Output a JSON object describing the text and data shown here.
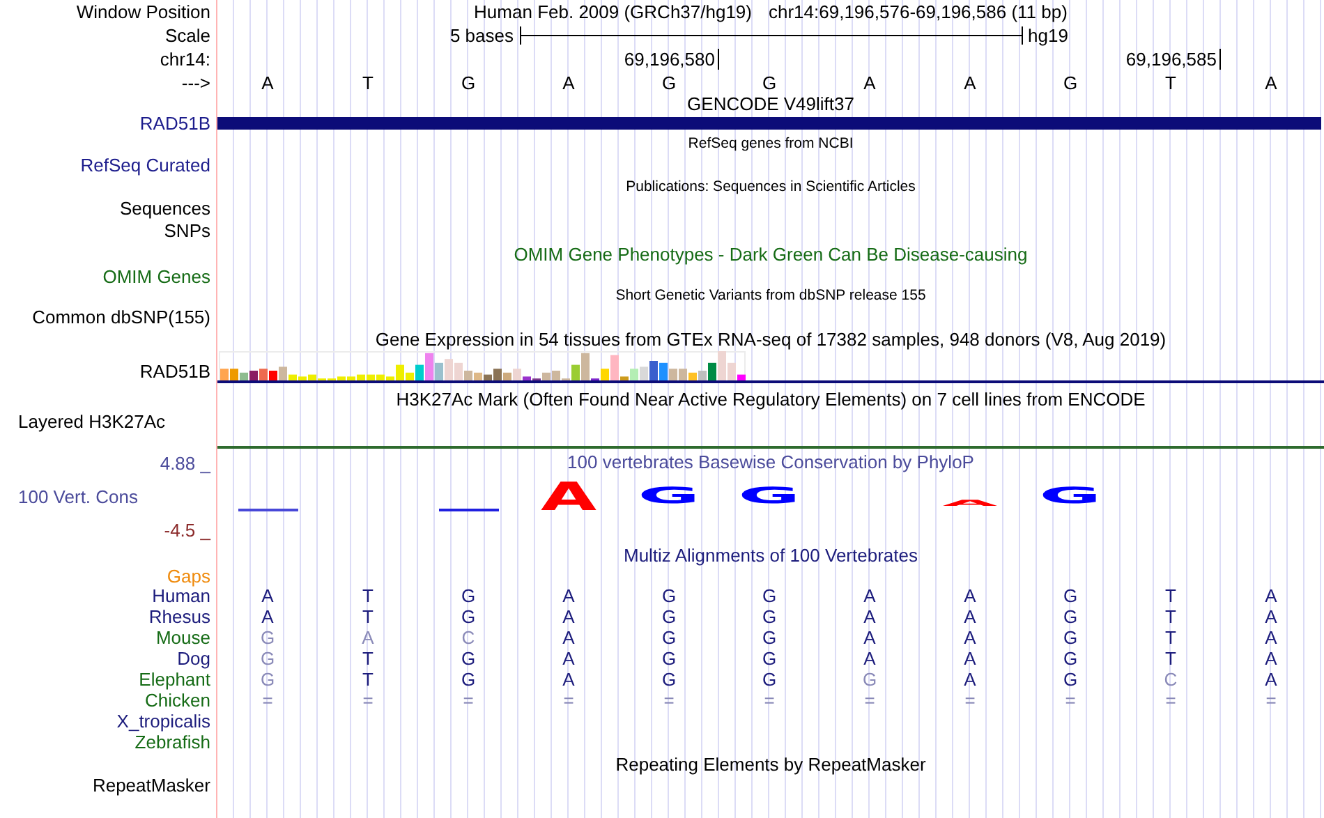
{
  "header": {
    "label": "Window Position",
    "title": "Human Feb. 2009 (GRCh37/hg19)",
    "position": "chr14:69,196,576-69,196,586 (11 bp)"
  },
  "scale": {
    "label": "Scale",
    "length": "5 bases",
    "assembly": "hg19"
  },
  "coordinates": {
    "label": "chr14:",
    "ticks": [
      "69,196,580",
      "69,196,585"
    ]
  },
  "strand": {
    "label": "--->",
    "bases": [
      "A",
      "T",
      "G",
      "A",
      "G",
      "G",
      "A",
      "A",
      "G",
      "T",
      "A"
    ]
  },
  "gencode": {
    "title": "GENCODE V49lift37",
    "label": "RAD51B"
  },
  "refseq": {
    "title": "RefSeq genes from NCBI",
    "label": "RefSeq Curated"
  },
  "publications": {
    "title": "Publications: Sequences in Scientific Articles",
    "labels": [
      "Sequences",
      "SNPs"
    ]
  },
  "omim": {
    "title": "OMIM Gene Phenotypes - Dark Green Can Be Disease-causing",
    "label": "OMIM Genes"
  },
  "dbsnp": {
    "title": "Short Genetic Variants from dbSNP release 155",
    "label": "Common dbSNP(155)"
  },
  "gtex": {
    "title": "Gene Expression in 54 tissues from GTEx RNA-seq of 17382 samples, 948 donors (V8, Aug 2019)",
    "label": "RAD51B"
  },
  "h3k27ac": {
    "title": "H3K27Ac Mark (Often Found Near Active Regulatory Elements) on 7 cell lines from ENCODE",
    "label": "Layered H3K27Ac"
  },
  "conservation": {
    "title": "100 vertebrates Basewise Conservation by PhyloP",
    "label": "100 Vert. Cons",
    "max": "4.88 _",
    "min": "-4.5 _",
    "logo": [
      {
        "kind": "dash",
        "color": "#4848d8"
      },
      {
        "kind": "none"
      },
      {
        "kind": "dash",
        "color": "#2020e0"
      },
      {
        "kind": "large",
        "letter": "A",
        "color": "#ff0000"
      },
      {
        "kind": "medium",
        "letter": "G",
        "color": "#0000ff"
      },
      {
        "kind": "medium",
        "letter": "G",
        "color": "#0000ff"
      },
      {
        "kind": "none"
      },
      {
        "kind": "small",
        "letter": "A",
        "color": "#ff0000"
      },
      {
        "kind": "medium",
        "letter": "G",
        "color": "#0000ff"
      },
      {
        "kind": "none"
      },
      {
        "kind": "none"
      }
    ]
  },
  "alignment": {
    "title": "Multiz Alignments of 100 Vertebrates",
    "gaps_label": "Gaps",
    "species": [
      {
        "name": "Human",
        "color": "#1c1c7c",
        "bases": [
          {
            "base": "A",
            "differs": false
          },
          {
            "base": "T",
            "differs": false
          },
          {
            "base": "G",
            "differs": false
          },
          {
            "base": "A",
            "differs": false
          },
          {
            "base": "G",
            "differs": false
          },
          {
            "base": "G",
            "differs": false
          },
          {
            "base": "A",
            "differs": false
          },
          {
            "base": "A",
            "differs": false
          },
          {
            "base": "G",
            "differs": false
          },
          {
            "base": "T",
            "differs": false
          },
          {
            "base": "A",
            "differs": false
          }
        ]
      },
      {
        "name": "Rhesus",
        "color": "#1c1c7c",
        "bases": [
          {
            "base": "A",
            "differs": false
          },
          {
            "base": "T",
            "differs": false
          },
          {
            "base": "G",
            "differs": false
          },
          {
            "base": "A",
            "differs": false
          },
          {
            "base": "G",
            "differs": false
          },
          {
            "base": "G",
            "differs": false
          },
          {
            "base": "A",
            "differs": false
          },
          {
            "base": "A",
            "differs": false
          },
          {
            "base": "G",
            "differs": false
          },
          {
            "base": "T",
            "differs": false
          },
          {
            "base": "A",
            "differs": false
          }
        ]
      },
      {
        "name": "Mouse",
        "color": "#156b15",
        "bases": [
          {
            "base": "G",
            "differs": true
          },
          {
            "base": "A",
            "differs": true
          },
          {
            "base": "C",
            "differs": true
          },
          {
            "base": "A",
            "differs": false
          },
          {
            "base": "G",
            "differs": false
          },
          {
            "base": "G",
            "differs": false
          },
          {
            "base": "A",
            "differs": false
          },
          {
            "base": "A",
            "differs": false
          },
          {
            "base": "G",
            "differs": false
          },
          {
            "base": "T",
            "differs": false
          },
          {
            "base": "A",
            "differs": false
          }
        ]
      },
      {
        "name": "Dog",
        "color": "#1c1c7c",
        "bases": [
          {
            "base": "G",
            "differs": true
          },
          {
            "base": "T",
            "differs": false
          },
          {
            "base": "G",
            "differs": false
          },
          {
            "base": "A",
            "differs": false
          },
          {
            "base": "G",
            "differs": false
          },
          {
            "base": "G",
            "differs": false
          },
          {
            "base": "A",
            "differs": false
          },
          {
            "base": "A",
            "differs": false
          },
          {
            "base": "G",
            "differs": false
          },
          {
            "base": "T",
            "differs": false
          },
          {
            "base": "A",
            "differs": false
          }
        ]
      },
      {
        "name": "Elephant",
        "color": "#156b15",
        "bases": [
          {
            "base": "G",
            "differs": true
          },
          {
            "base": "T",
            "differs": false
          },
          {
            "base": "G",
            "differs": false
          },
          {
            "base": "A",
            "differs": false
          },
          {
            "base": "G",
            "differs": false
          },
          {
            "base": "G",
            "differs": false
          },
          {
            "base": "G",
            "differs": true
          },
          {
            "base": "A",
            "differs": false
          },
          {
            "base": "G",
            "differs": false
          },
          {
            "base": "C",
            "differs": true
          },
          {
            "base": "A",
            "differs": false
          }
        ]
      },
      {
        "name": "Chicken",
        "color": "#156b15",
        "bases": [
          {
            "base": "=",
            "differs": true
          },
          {
            "base": "=",
            "differs": true
          },
          {
            "base": "=",
            "differs": true
          },
          {
            "base": "=",
            "differs": true
          },
          {
            "base": "=",
            "differs": true
          },
          {
            "base": "=",
            "differs": true
          },
          {
            "base": "=",
            "differs": true
          },
          {
            "base": "=",
            "differs": true
          },
          {
            "base": "=",
            "differs": true
          },
          {
            "base": "=",
            "differs": true
          },
          {
            "base": "=",
            "differs": true
          }
        ]
      },
      {
        "name": "X_tropicalis",
        "color": "#1c1c7c"
      },
      {
        "name": "Zebrafish",
        "color": "#156b15"
      }
    ]
  },
  "repeatmasker": {
    "title": "Repeating Elements by RepeatMasker",
    "label": "RepeatMasker"
  }
}
